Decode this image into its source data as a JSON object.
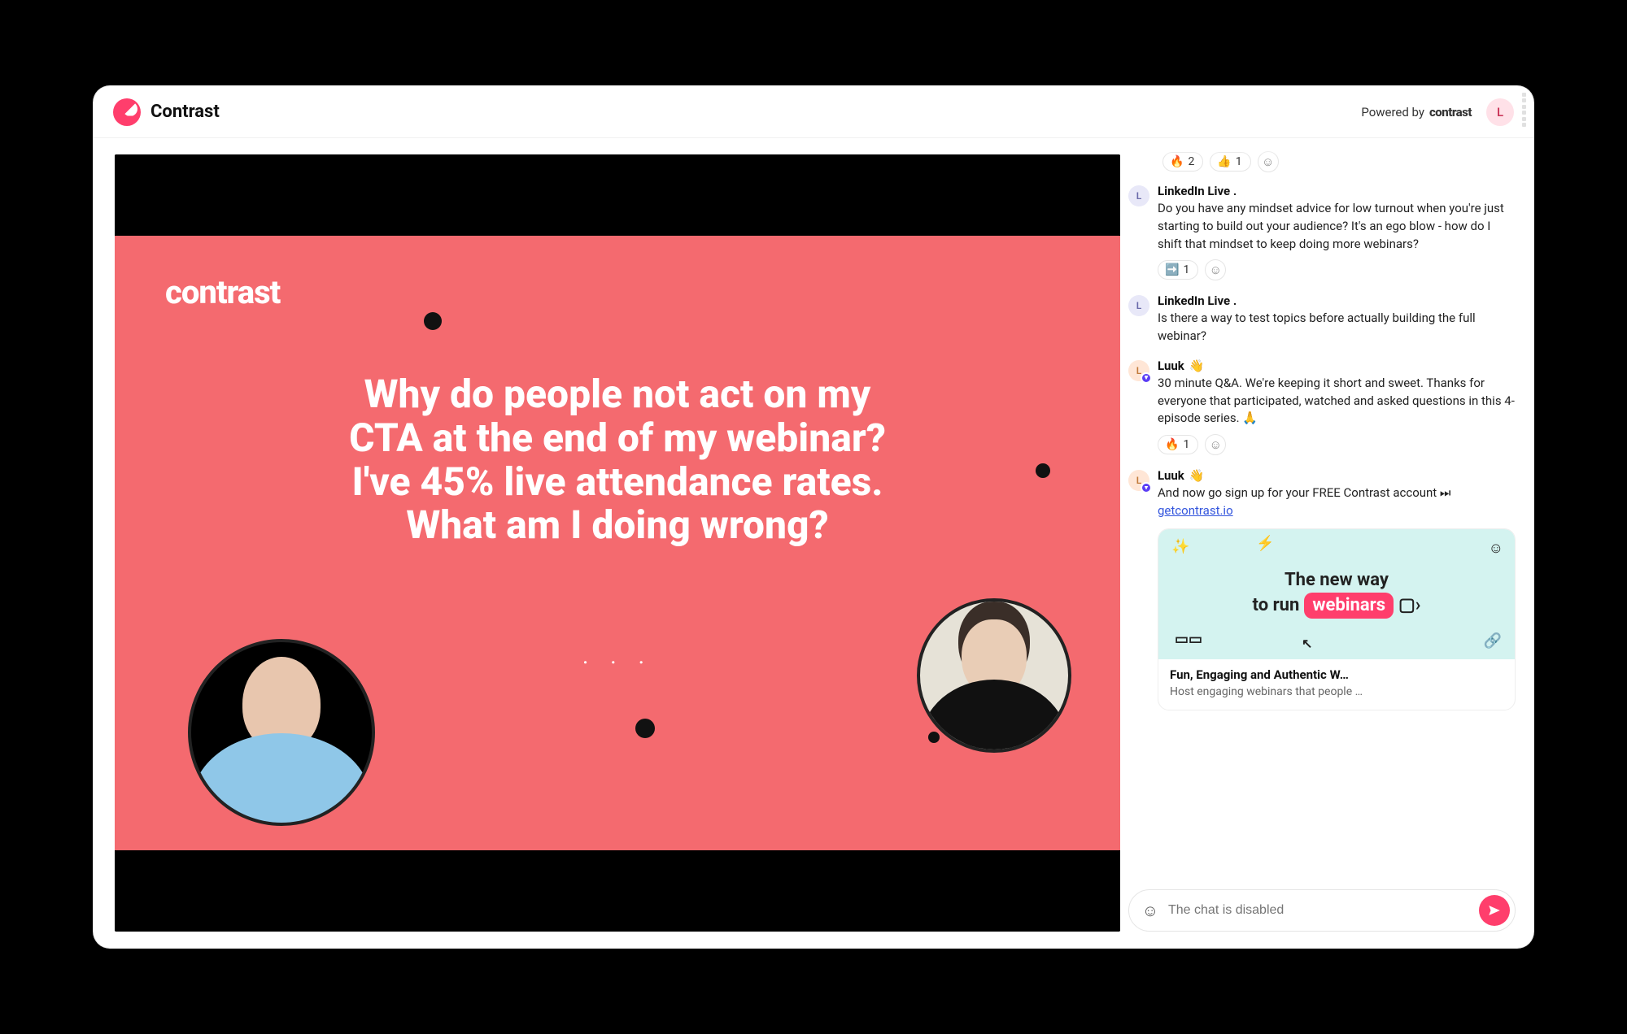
{
  "brand": "Contrast",
  "powered_by_label": "Powered by",
  "powered_by_brand": "contrast",
  "user_initial": "L",
  "slide": {
    "logo": "contrast",
    "title": "Why do people not act on my CTA at the end of my webinar? I've 45% live attendance rates. What am I doing wrong?",
    "ellipsis": ". . ."
  },
  "topReactions": [
    {
      "emoji": "🔥",
      "count": "2"
    },
    {
      "emoji": "👍",
      "count": "1"
    }
  ],
  "messages": [
    {
      "avatar": "L",
      "avatarStyle": "blue",
      "name": "LinkedIn Live .",
      "text": "Do you have any mindset advice for low turnout when you're just starting to build out your audience? It's an ego blow - how do I shift that mindset to keep doing more webinars?",
      "reactions": [
        {
          "emoji": "➡️",
          "count": "1"
        }
      ]
    },
    {
      "avatar": "L",
      "avatarStyle": "blue",
      "name": "LinkedIn Live .",
      "text": "Is there a way to test topics before actually building the full webinar?"
    },
    {
      "avatar": "L",
      "avatarStyle": "pink",
      "badge": true,
      "name": "Luuk",
      "wave": "👋",
      "text": "30 minute Q&A. We're keeping it short and sweet. Thanks for everyone that participated, watched and asked questions in this 4-episode series. 🙏",
      "reactions": [
        {
          "emoji": "🔥",
          "count": "1"
        }
      ]
    },
    {
      "avatar": "L",
      "avatarStyle": "pink",
      "badge": true,
      "name": "Luuk",
      "wave": "👋",
      "textPrefix": "And now go sign up for your FREE Contrast account ⏭ ",
      "link": "getcontrast.io"
    }
  ],
  "promo": {
    "line1": "The new way",
    "line2a": "to run",
    "pill": "webinars",
    "title": "Fun, Engaging and Authentic W…",
    "subtitle": "Host engaging webinars that people …"
  },
  "chatInput": {
    "placeholder": "The chat is disabled"
  }
}
